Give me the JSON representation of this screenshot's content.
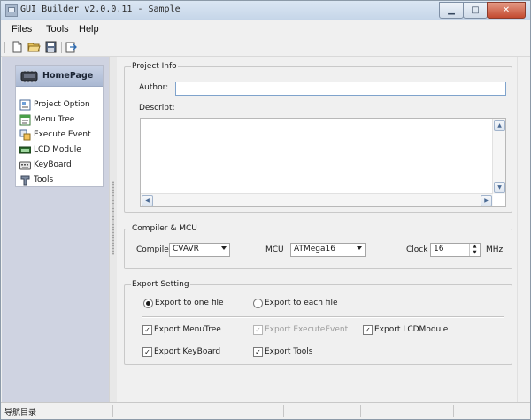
{
  "window": {
    "title": "GUI Builder v2.0.0.11 - Sample"
  },
  "menu": [
    "Files",
    "Tools",
    "Help"
  ],
  "toolbar": {
    "icons": [
      "new-file-icon",
      "open-folder-icon",
      "save-icon",
      "export-icon"
    ]
  },
  "nav": {
    "header": "HomePage",
    "items": [
      {
        "label": "Project Option",
        "icon": "project-option-icon"
      },
      {
        "label": "Menu Tree",
        "icon": "menu-tree-icon"
      },
      {
        "label": "Execute Event",
        "icon": "execute-event-icon"
      },
      {
        "label": "LCD Module",
        "icon": "lcd-module-icon"
      },
      {
        "label": "KeyBoard",
        "icon": "keyboard-icon"
      },
      {
        "label": "Tools",
        "icon": "tools-icon"
      }
    ]
  },
  "project_info": {
    "title": "Project Info",
    "author_label": "Author:",
    "author_value": "",
    "descript_label": "Descript:",
    "descript_value": ""
  },
  "compiler": {
    "title": "Compiler & MCU",
    "compiler_label": "Compiler",
    "compiler_value": "CVAVR",
    "mcu_label": "MCU",
    "mcu_value": "ATMega16",
    "clock_label": "Clock",
    "clock_value": "16",
    "clock_unit": "MHz"
  },
  "export": {
    "title": "Export Setting",
    "radio_one": "Export to one file",
    "radio_each": "Export to each file",
    "selected": "one",
    "checks": [
      {
        "label": "Export MenuTree",
        "checked": true,
        "disabled": false
      },
      {
        "label": "Export ExecuteEvent",
        "checked": true,
        "disabled": true
      },
      {
        "label": "Export LCDModule",
        "checked": true,
        "disabled": false
      },
      {
        "label": "Export KeyBoard",
        "checked": true,
        "disabled": false
      },
      {
        "label": "Export Tools",
        "checked": true,
        "disabled": false
      }
    ]
  },
  "status": {
    "text": "导航目录"
  },
  "colors": {
    "titlebar": "#c5d5e8",
    "leftpane": "#cfd3e1",
    "close_button": "#c34a31",
    "textbox_border": "#7fa3cc"
  }
}
